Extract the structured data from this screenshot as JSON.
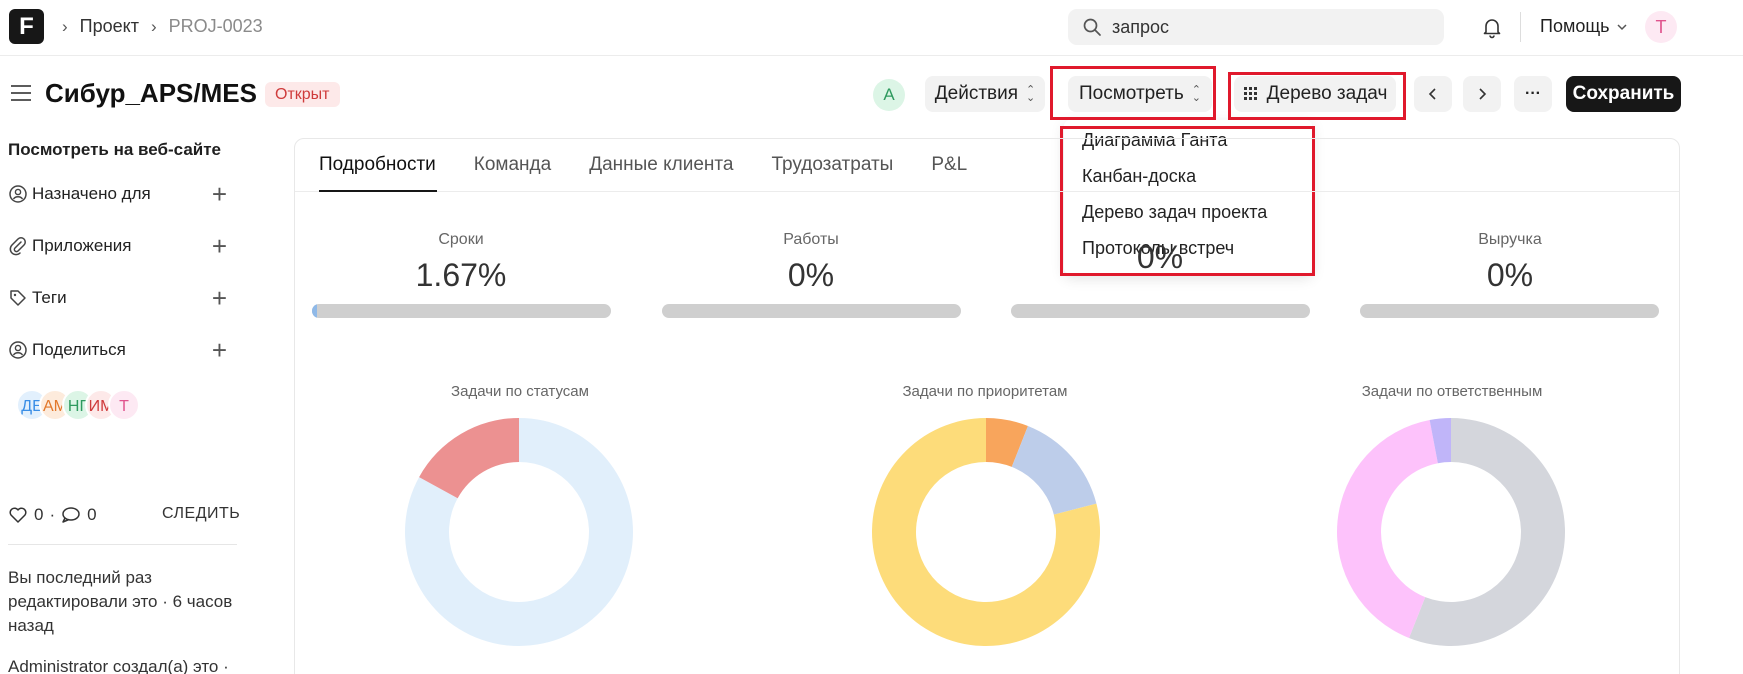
{
  "navbar": {
    "logo": "F",
    "breadcrumbs": [
      "Проект",
      "PROJ-0023"
    ],
    "search_value": "запрос",
    "help_label": "Помощь",
    "user_initial": "T"
  },
  "header": {
    "title": "Сибур_APS/MES",
    "status": "Открыт",
    "assignee_initial": "A",
    "actions_label": "Действия",
    "view_label": "Посмотреть",
    "tree_label": "Дерево задач",
    "more_label": "···",
    "save_label": "Сохранить"
  },
  "view_menu": {
    "items": [
      "Диаграмма Ганта",
      "Канбан-доска",
      "Дерево задач проекта",
      "Протоколы встреч"
    ]
  },
  "sidebar": {
    "website_link": "Посмотреть на веб-сайте",
    "rows": [
      "Назначено для",
      "Приложения",
      "Теги",
      "Поделиться"
    ],
    "avatars": [
      {
        "initials": "ДЕ",
        "bg": "#e2f0fd",
        "fg": "#3a8ee6"
      },
      {
        "initials": "АМ",
        "bg": "#fdebdc",
        "fg": "#e2782b"
      },
      {
        "initials": "НГ",
        "bg": "#dcf5e6",
        "fg": "#2f9a5f"
      },
      {
        "initials": "ИМ",
        "bg": "#fde9e9",
        "fg": "#cf3b3b"
      },
      {
        "initials": "T",
        "bg": "#fde9f3",
        "fg": "#e0548e"
      }
    ],
    "likes": "0",
    "comments": "0",
    "follow_label": "СЛЕДИТЬ",
    "edited_text": "Вы последний раз редактировали это · 6 часов назад",
    "created_text": "Administrator создал(а) это ·"
  },
  "tabs": [
    "Подробности",
    "Команда",
    "Данные клиента",
    "Трудозатраты",
    "P&L"
  ],
  "metrics": [
    {
      "label": "Сроки",
      "value": "1.67%",
      "progress": 0.0167
    },
    {
      "label": "Работы",
      "value": "0%",
      "progress": 0
    },
    {
      "label": "",
      "value": "0%",
      "progress": 0
    },
    {
      "label": "Выручка",
      "value": "0%",
      "progress": 0
    }
  ],
  "chart_data": [
    {
      "type": "pie",
      "title": "Задачи по статусам",
      "slices": [
        {
          "value": 83,
          "color": "#e1effb"
        },
        {
          "value": 17,
          "color": "#ec9191"
        }
      ]
    },
    {
      "type": "pie",
      "title": "Задачи по приоритетам",
      "slices": [
        {
          "value": 6,
          "color": "#f8a55c"
        },
        {
          "value": 15,
          "color": "#bdcdea"
        },
        {
          "value": 79,
          "color": "#fddc7a"
        }
      ]
    },
    {
      "type": "pie",
      "title": "Задачи по ответственным",
      "slices": [
        {
          "value": 56,
          "color": "#d4d6dc"
        },
        {
          "value": 41,
          "color": "#fdc2fb"
        },
        {
          "value": 3,
          "color": "#c0b5f9"
        }
      ]
    }
  ]
}
